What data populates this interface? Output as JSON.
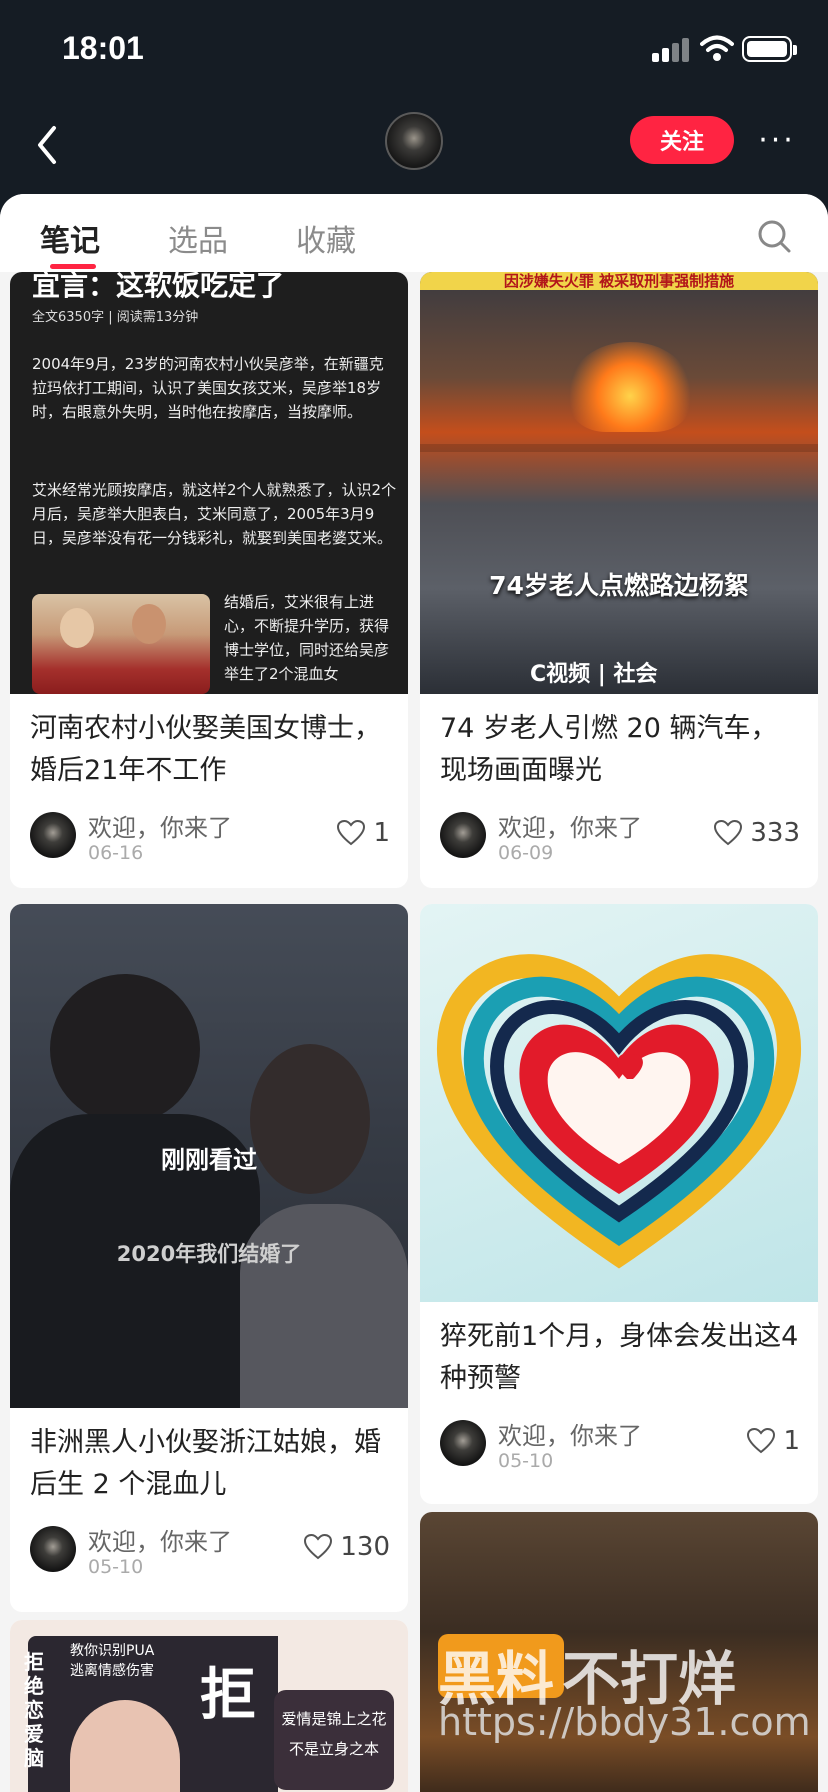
{
  "status": {
    "time": "18:01"
  },
  "header": {
    "follow_label": "关注",
    "more_label": "···"
  },
  "tabs": [
    {
      "label": "笔记",
      "active": true
    },
    {
      "label": "选品",
      "active": false
    },
    {
      "label": "收藏",
      "active": false
    }
  ],
  "cards": [
    {
      "title": "河南农村小伙娶美国女博士，婚后21年不工作",
      "user": "欢迎，你来了",
      "date": "06-16",
      "likes": "1",
      "image": {
        "head": "宜言：这软饭吃定了",
        "meta": "全文6350字 | 阅读需13分钟",
        "p1": "2004年9月，23岁的河南农村小伙吴彦举，在新疆克拉玛依打工期间，认识了美国女孩艾米，吴彦举18岁时，右眼意外失明，当时他在按摩店，当按摩师。",
        "p2": "艾米经常光顾按摩店，就这样2个人就熟悉了，认识2个月后，吴彦举大胆表白，艾米同意了，2005年3月9日，吴彦举没有花一分钱彩礼，就娶到美国老婆艾米。",
        "p3": "结婚后，艾米很有上进心，不断提升学历，获得博士学位，同时还给吴彦举生了2个混血女"
      }
    },
    {
      "title": "74 岁老人引燃 20 辆汽车，现场画面曝光",
      "user": "欢迎，你来了",
      "date": "06-09",
      "likes": "333",
      "image": {
        "banner": "因涉嫌失火罪 被采取刑事强制措施",
        "caption": "74岁老人点燃路边杨絮",
        "source": "C视频 | 社会"
      }
    },
    {
      "title": "非洲黑人小伙娶浙江姑娘，婚后生 2 个混血儿",
      "user": "欢迎，你来了",
      "date": "05-10",
      "likes": "130",
      "image": {
        "recent": "刚刚看过",
        "caption": "2020年我们结婚了"
      }
    },
    {
      "title": "猝死前1个月，身体会发出这4种预警",
      "user": "欢迎，你来了",
      "date": "05-10",
      "likes": "1"
    },
    {
      "image": {
        "t1": "教你识别PUA",
        "t2": "逃离情感伤害",
        "big": "拒",
        "vertical": "拒绝恋爱脑",
        "quote1": "爱情是锦上之花",
        "quote2": "不是立身之本"
      }
    },
    {
      "image": {
        "logo": "黑料",
        "logo2": "不打烊",
        "url": "https://bbdy31.com"
      }
    }
  ],
  "colors": {
    "accent": "#ff2442",
    "topbar": "#151c24"
  }
}
